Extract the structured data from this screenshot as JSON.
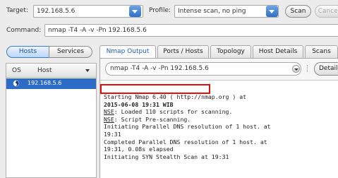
{
  "toolbar": {
    "target_label": "Target:",
    "target_value": "192.168.5.6",
    "profile_label": "Profile:",
    "profile_value": "Intense scan, no ping",
    "scan_button": "Scan",
    "cancel_button": "Cancel"
  },
  "command": {
    "label": "Command:",
    "value": "nmap -T4 -A -v -Pn 192.168.5.6"
  },
  "left_pane": {
    "hosts_toggle": "Hosts",
    "services_toggle": "Services",
    "columns": {
      "os": "OS",
      "host": "Host"
    },
    "hosts": [
      {
        "os_icon": "os-generic-icon",
        "ip": "192.168.5.6"
      }
    ]
  },
  "tabs": [
    {
      "label": "Nmap Output",
      "active": true
    },
    {
      "label": "Ports / Hosts"
    },
    {
      "label": "Topology"
    },
    {
      "label": "Host Details"
    },
    {
      "label": "Scans"
    }
  ],
  "output_panel": {
    "command_select": "nmap -T4 -A -v -Pn 192.168.5.6",
    "details_button": "Details",
    "lines": {
      "l1a": "Starting Nmap 6.40 ( ",
      "l1link": "http://nmap.org",
      "l1b": " ) at",
      "l2": "2015-06-08 19:31 WIB",
      "l3a": "NSE",
      "l3b": ": Loaded 110 scripts for scanning.",
      "l4a": "NSE",
      "l4b": ": Script Pre-scanning.",
      "l5": "Initiating Parallel DNS resolution of 1 host. at",
      "l6": "19:31",
      "l7": "Completed Parallel DNS resolution of 1 host. at",
      "l8": "19:31, 0.08s elapsed",
      "l9": "Initiating SYN Stealth Scan at 19:31"
    }
  },
  "colors": {
    "accent": "#2d6cc6",
    "highlight_box": "#e01010"
  }
}
